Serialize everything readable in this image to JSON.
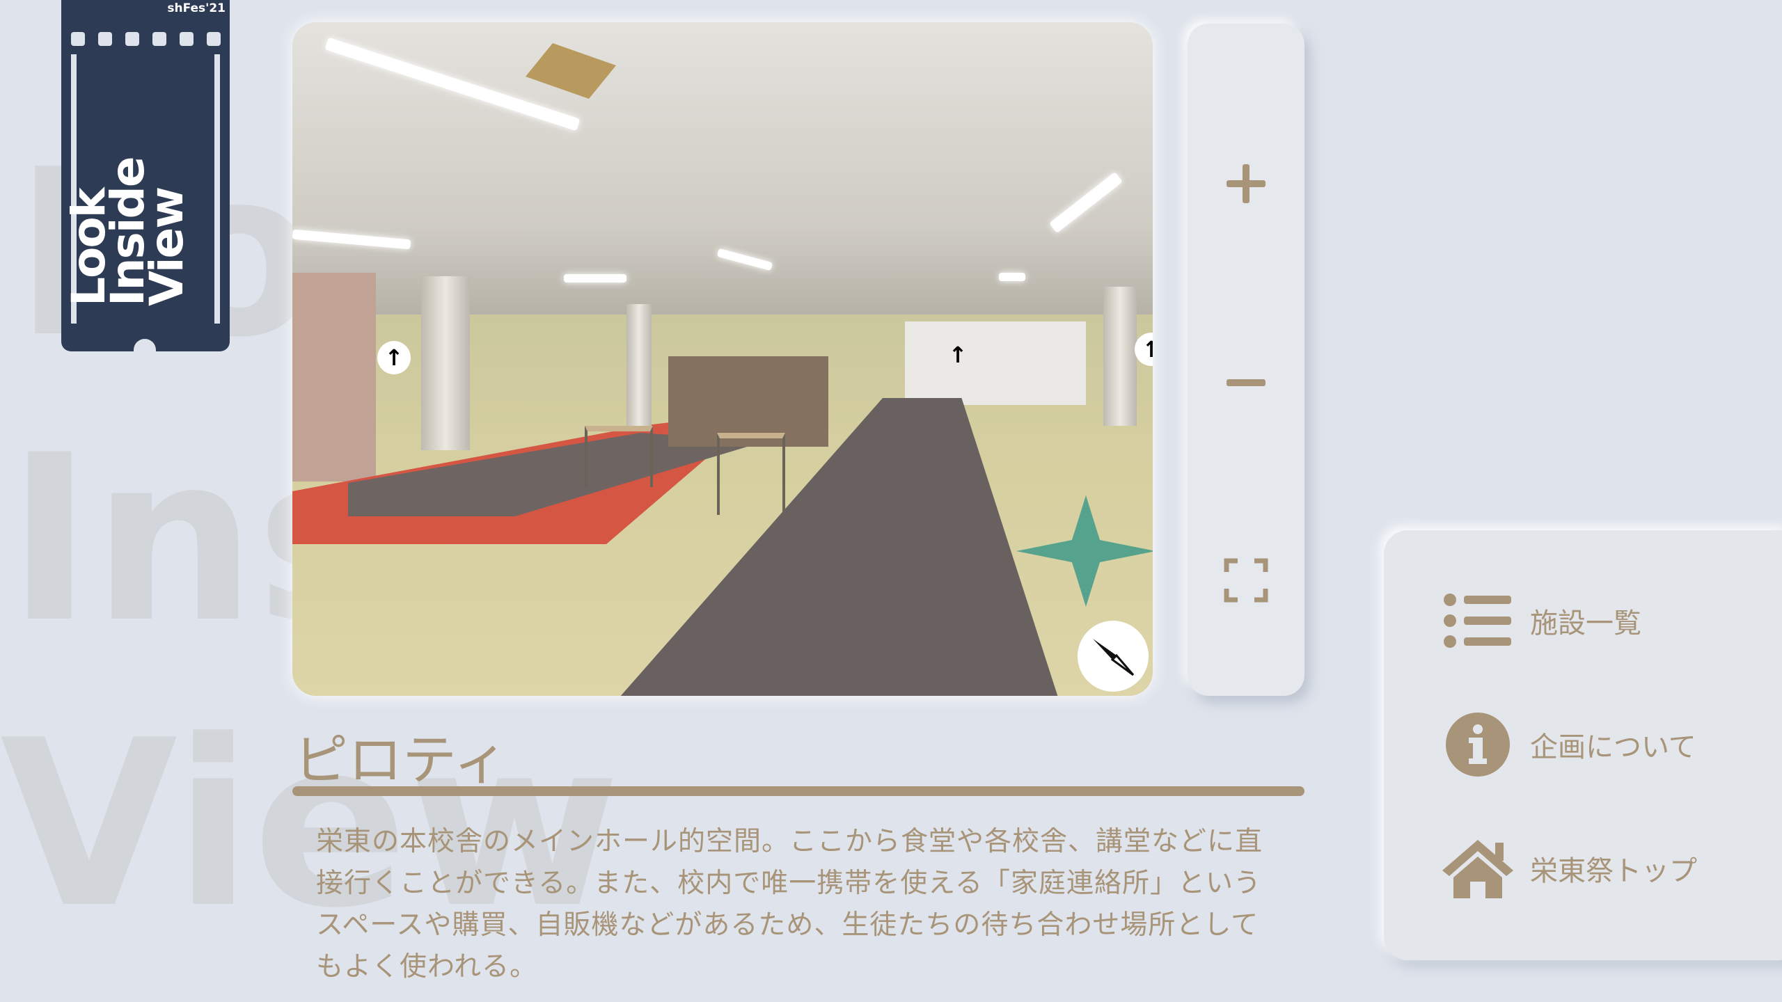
{
  "logo": {
    "event_tag": "shFes'21",
    "line1": "Look",
    "line2": "Inside",
    "line3": "View"
  },
  "viewer": {
    "hotspot_symbol": "↑"
  },
  "controls": {
    "zoom_in": "+",
    "zoom_out": "−"
  },
  "place": {
    "title": "ピロティ",
    "description": "栄東の本校舎のメインホール的空間。ここから食堂や各校舎、講堂などに直接行くことができる。また、校内で唯一携帯を使える「家庭連絡所」というスペースや購買、自販機などがあるため、生徒たちの待ち合わせ場所としてもよく使われる。"
  },
  "menu": {
    "items": [
      {
        "label": "施設一覧",
        "icon": "list-icon"
      },
      {
        "label": "企画について",
        "icon": "info-icon"
      },
      {
        "label": "栄東祭トップ",
        "icon": "home-icon"
      }
    ]
  },
  "colors": {
    "background": "#dfe4ec",
    "accent": "#a89478",
    "logo": "#2e3b55"
  }
}
